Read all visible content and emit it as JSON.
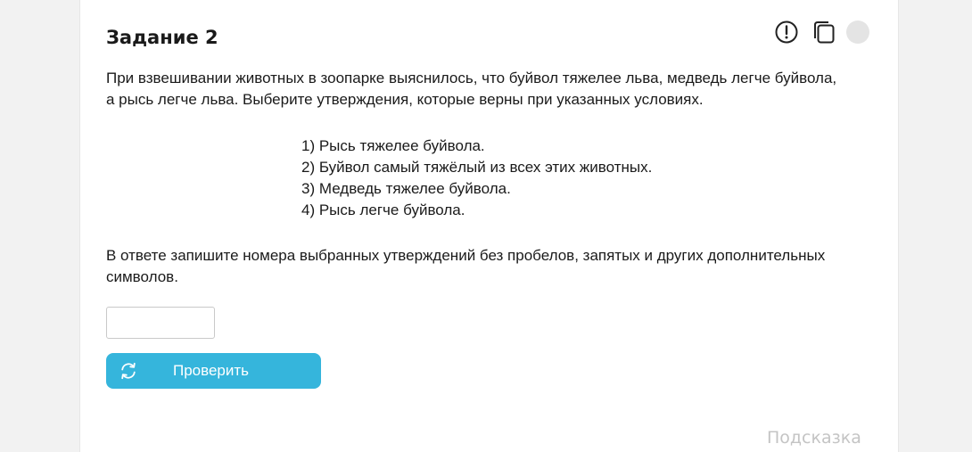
{
  "task": {
    "title": "Задание 2",
    "prompt": "При взвешивании животных в зоопарке выяснилось, что буйвол тяжелее льва, медведь легче буйвола, а рысь легче льва. Выберите утверждения, которые верны при указанных условиях.",
    "statements": [
      "1) Рысь тяжелее буйвола.",
      "2) Буйвол самый тяжёлый из всех этих животных.",
      "3) Медведь тяжелее буйвола.",
      "4) Рысь легче буйвола."
    ],
    "instruction": "В ответе запишите номера выбранных утверждений без пробелов, запятых и других дополнительных символов."
  },
  "toolbar": {
    "icons": [
      "report-icon",
      "copy-icon",
      "status-dot-icon"
    ]
  },
  "answer": {
    "value": "",
    "placeholder": ""
  },
  "check_button": {
    "label": "Проверить",
    "icon": "refresh-icon",
    "color": "#35b5dc"
  },
  "hint": {
    "label": "Подсказка"
  }
}
